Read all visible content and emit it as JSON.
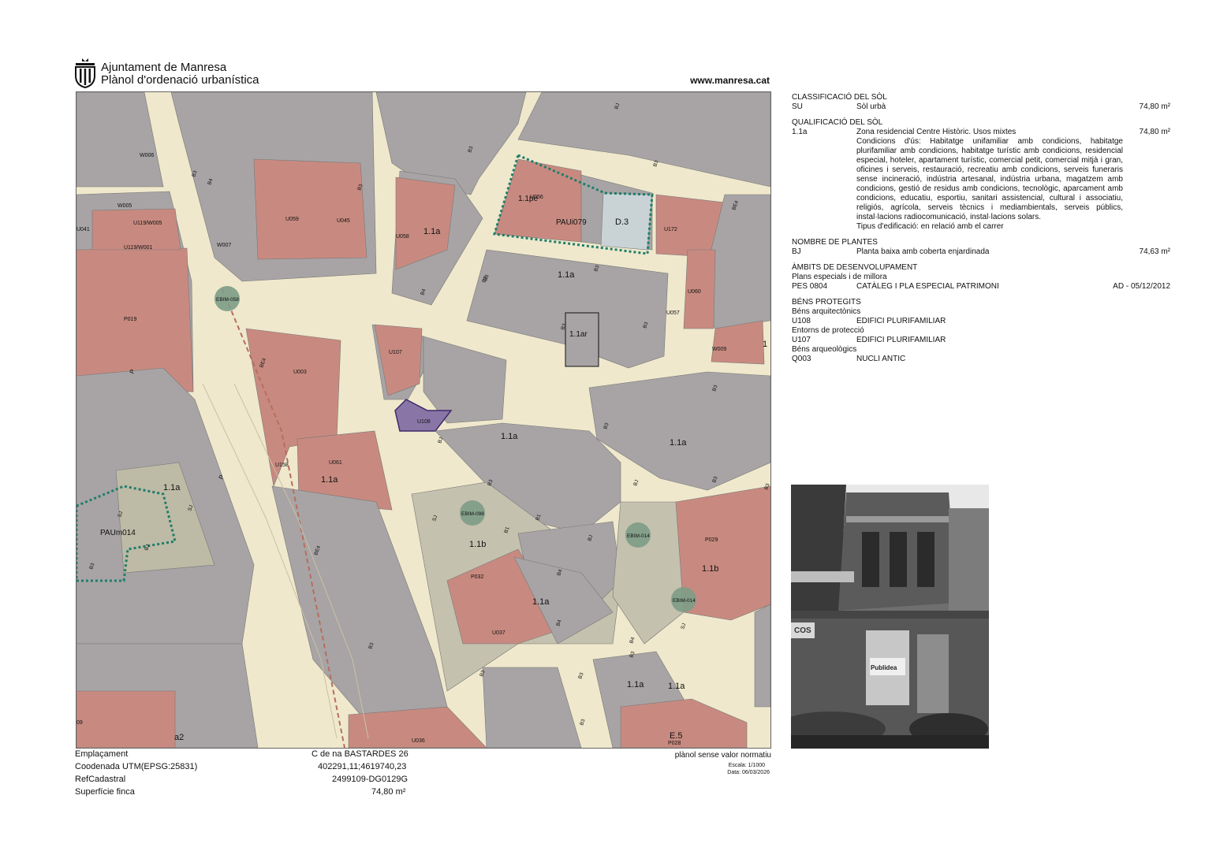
{
  "header": {
    "org": "Ajuntament de Manresa",
    "plan": "Plànol d'ordenació urbanística",
    "site": "www.manresa.cat"
  },
  "map": {
    "zone_labels": [
      "1.1pe",
      "1.1a",
      "1.1a",
      "1.1ar",
      "1.1a",
      "1.1a",
      "1.1a",
      "1.1a",
      "1.1a",
      "1.1b",
      "1.1b",
      "1.1a",
      "1.1a",
      "D.3",
      "E.5",
      "a2",
      "PAUi079",
      "PAUm014",
      "1"
    ],
    "parcel_codes": [
      "W006",
      "W005",
      "U041",
      "U119/W005",
      "U119/W001",
      "W007",
      "U059",
      "U045",
      "U058",
      "U056",
      "U172",
      "U060",
      "U057",
      "W009",
      "U107",
      "U003",
      "U108",
      "U158",
      "U061",
      "P019",
      "P032",
      "U037",
      "U036",
      "P029",
      "P028",
      "09"
    ],
    "height_codes": [
      "BJ",
      "B3",
      "B4",
      "B3",
      "B3",
      "BE4",
      "BE4",
      "BE4",
      "B3",
      "B3",
      "B3",
      "B4",
      "B3",
      "B3",
      "B3",
      "B3",
      "B3",
      "B3",
      "B3",
      "B3",
      "BJ",
      "BJ",
      "BJ",
      "SJ",
      "SJ",
      "SJ",
      "B1",
      "B1",
      "B4",
      "B4",
      "B3",
      "B3",
      "B3",
      "B3",
      "SJ",
      "BJ",
      "B3",
      "B3",
      "B4"
    ],
    "street_codes": [
      "P",
      "P"
    ],
    "equipment": [
      "EBIM-058",
      "EBIM-098",
      "EBIM-014",
      "EBIM-014"
    ],
    "highlight_parcel": "U108",
    "colors": {
      "street": "#efe8cc",
      "building": "#a8a4a5",
      "protected": "#c88a80",
      "green": "#c4c1ae",
      "highlight": "#8a76a6",
      "plan_border": "#1e7e6a",
      "equipment": "#7d9c86"
    }
  },
  "footer": {
    "rows": [
      {
        "label": "Emplaçament",
        "value": "C de na BASTARDES 26"
      },
      {
        "label": "Coodenada UTM(EPSG:25831)",
        "value": "402291,11;4619740,23"
      },
      {
        "label": "RefCadastral",
        "value": "2499109-DG0129G"
      },
      {
        "label": "Superfície finca",
        "value": "74,80 m²"
      }
    ],
    "disclaimer": "plànol sense valor normatiu",
    "scale": "Escala: 1/1000",
    "date": "Data: 06/03/2026"
  },
  "panel": {
    "classificacio": {
      "title": "CLASSIFICACIÓ DEL SÒL",
      "code": "SU",
      "desc": "Sòl urbà",
      "value": "74,80 m²"
    },
    "qualificacio": {
      "title": "QUALIFICACIÓ DEL SÒL",
      "code": "1.1a",
      "desc": "Zona residencial Centre Històric. Usos mixtes",
      "value": "74,80 m²",
      "conditions": "Condicions d'ús: Habitatge unifamiliar amb condicions, habitatge plurifamiliar amb condicions, habitatge turístic amb condicions, residencial especial, hoteler, apartament turístic, comercial petit, comercial mitjà i gran, oficines i serveis, restauració, recreatiu amb condicions, serveis funeraris sense incineració, indústria artesanal, indústria urbana, magatzem amb condicions, gestió de residus amb condicions, tecnològic, aparcament amb condicions, educatiu, esportiu, sanitari assistencial, cultural i associatiu, religiós, agrícola, serveis tècnics i mediambientals, serveis públics, instal·lacions radiocomunicació, instal·lacions solars.",
      "edification": "Tipus d'edificació: en relació amb el carrer"
    },
    "plantes": {
      "title": "NOMBRE DE PLANTES",
      "code": "BJ",
      "desc": "Planta baixa amb coberta enjardinada",
      "value": "74,63 m²"
    },
    "ambits": {
      "title": "ÀMBITS DE DESENVOLUPAMENT",
      "subtitle": "Plans especials i de millora",
      "code": "PES 0804",
      "desc": "CATÀLEG I PLA ESPECIAL PATRIMONI",
      "value": "AD - 05/12/2012"
    },
    "bens": {
      "title": "BÉNS PROTEGITS",
      "groups": [
        {
          "subtitle": "Béns arquitectònics",
          "code": "U108",
          "desc": "EDIFICI PLURIFAMILIAR"
        },
        {
          "subtitle": "Entorns de protecció",
          "code": "U107",
          "desc": "EDIFICI PLURIFAMILIAR"
        },
        {
          "subtitle": "Béns arqueològics",
          "code": "Q003",
          "desc": "NUCLI ANTIC"
        }
      ]
    }
  },
  "photo": {
    "signs": [
      "COS",
      "Publidea"
    ]
  }
}
